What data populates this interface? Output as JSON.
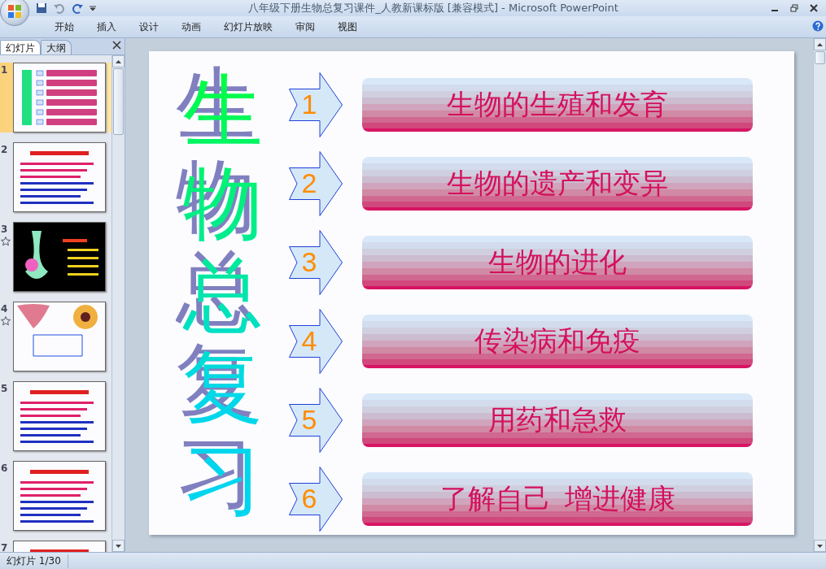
{
  "window": {
    "title": "八年级下册生物总复习课件_人教新课标版 [兼容模式] - Microsoft PowerPoint"
  },
  "ribbon_tabs": [
    {
      "label": "开始",
      "selected": false
    },
    {
      "label": "插入",
      "selected": false
    },
    {
      "label": "设计",
      "selected": false
    },
    {
      "label": "动画",
      "selected": false
    },
    {
      "label": "幻灯片放映",
      "selected": false
    },
    {
      "label": "审阅",
      "selected": false
    },
    {
      "label": "视图",
      "selected": false
    }
  ],
  "panel_tabs": [
    {
      "label": "幻灯片",
      "selected": true
    },
    {
      "label": "大纲",
      "selected": false
    }
  ],
  "thumbnails": [
    {
      "number": "1",
      "kind": "menu",
      "selected": true,
      "has_animation": false
    },
    {
      "number": "2",
      "kind": "text",
      "selected": false,
      "has_animation": false
    },
    {
      "number": "3",
      "kind": "dark",
      "selected": false,
      "has_animation": true
    },
    {
      "number": "4",
      "kind": "flower",
      "selected": false,
      "has_animation": true
    },
    {
      "number": "5",
      "kind": "text",
      "selected": false,
      "has_animation": false
    },
    {
      "number": "6",
      "kind": "text",
      "selected": false,
      "has_animation": false
    },
    {
      "number": "7",
      "kind": "text",
      "selected": false,
      "has_animation": false
    }
  ],
  "slide": {
    "title": "生物总复习",
    "items": [
      {
        "number": "1",
        "label": "生物的生殖和发育"
      },
      {
        "number": "2",
        "label": "生物的遗产和变异"
      },
      {
        "number": "3",
        "label": "生物的进化"
      },
      {
        "number": "4",
        "label": "传染病和免疫"
      },
      {
        "number": "5",
        "label": "用药和急救"
      },
      {
        "number": "6",
        "label": "了解自己  增进健康"
      }
    ]
  },
  "status_bar": {
    "slide_counter": "幻灯片 1/30"
  }
}
